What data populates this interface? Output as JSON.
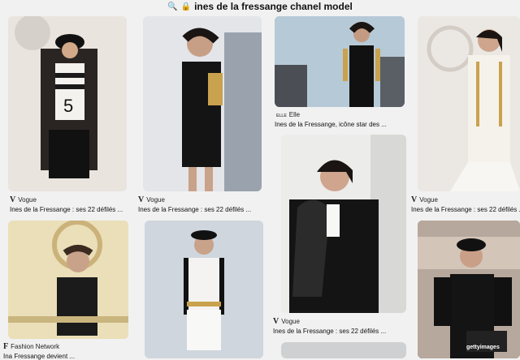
{
  "search": {
    "query": "ines de la fressange chanel model"
  },
  "pins": [
    {
      "id": "p1",
      "source_initial": "V",
      "source": "Vogue",
      "caption": "Ines de la Fressange : ses 22 défilés ..."
    },
    {
      "id": "p2",
      "source_initial": "V",
      "source": "Vogue",
      "caption": "Ines de la Fressange : ses 22 défilés ..."
    },
    {
      "id": "p3",
      "source_initial": "ELLE",
      "source": "Elle",
      "caption": "Ines de la Fressange, icône star des ..."
    },
    {
      "id": "p4",
      "source_initial": "V",
      "source": "Vogue",
      "caption": "Ines de la Fressange : ses 22 défilés ..."
    },
    {
      "id": "p5",
      "source_initial": "F",
      "source": "Fashion Network",
      "caption": "Ina Fressange devient ..."
    },
    {
      "id": "p6",
      "source_initial": "V",
      "source": "Vogue",
      "caption": "Ines de la Fressange : ses 22 défilés ..."
    }
  ],
  "watermark": {
    "text": "gettyimages"
  },
  "colors": {
    "bg": "#f1f1f1",
    "text": "#111111"
  }
}
